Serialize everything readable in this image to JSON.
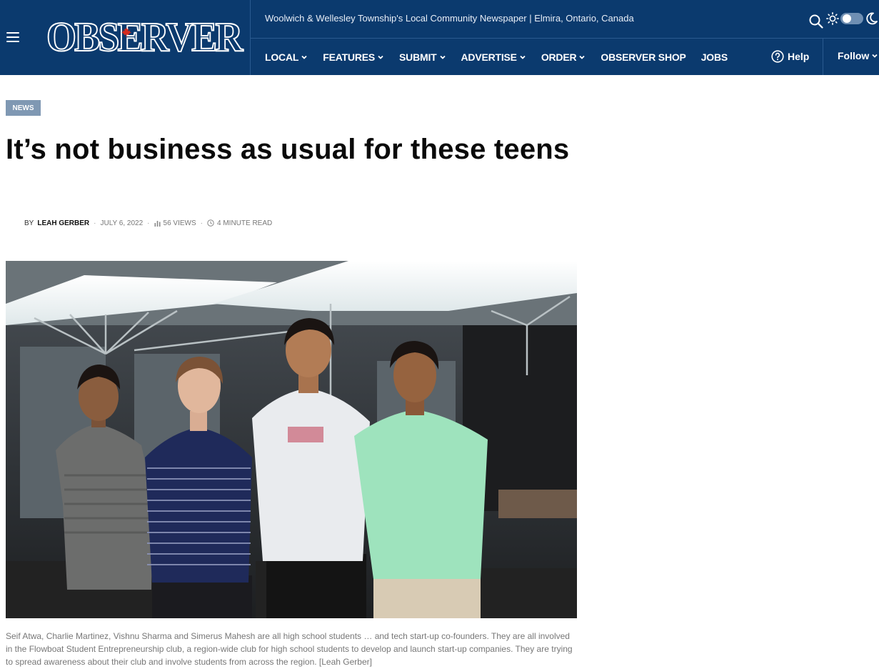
{
  "header": {
    "logo_text": "OBSERVER",
    "tagline": "Woolwich & Wellesley Township's Local Community Newspaper | Elmira, Ontario, Canada",
    "nav": [
      {
        "label": "LOCAL",
        "has_dropdown": true
      },
      {
        "label": "FEATURES",
        "has_dropdown": true
      },
      {
        "label": "SUBMIT",
        "has_dropdown": true
      },
      {
        "label": "ADVERTISE",
        "has_dropdown": true
      },
      {
        "label": "ORDER",
        "has_dropdown": true
      },
      {
        "label": "OBSERVER SHOP",
        "has_dropdown": false
      },
      {
        "label": "JOBS",
        "has_dropdown": false
      }
    ],
    "help_label": "Help",
    "follow_label": "Follow",
    "icons": [
      "menu-icon",
      "search-icon",
      "sun-icon",
      "moon-icon",
      "help-icon"
    ]
  },
  "article": {
    "category": "NEWS",
    "title": "It’s not business as usual for these teens",
    "by": "BY",
    "author": "LEAH GERBER",
    "date": "JULY 6, 2022",
    "views": "56 VIEWS",
    "read_time": "4 MINUTE READ",
    "caption": "Seif Atwa, Charlie Martinez, Vishnu Sharma and Simerus Mahesh are all high school students … and tech start-up co-founders. They are all involved in the Flowboat Student Entrepreneurship club, a region-wide club for high school students to develop and launch start-up companies. They are trying to spread awareness about their club and involve students from across the region. [Leah Gerber]"
  },
  "colors": {
    "header_bg": "#0b3a6e",
    "badge_bg": "#7f98b3",
    "text_muted": "#777777"
  }
}
